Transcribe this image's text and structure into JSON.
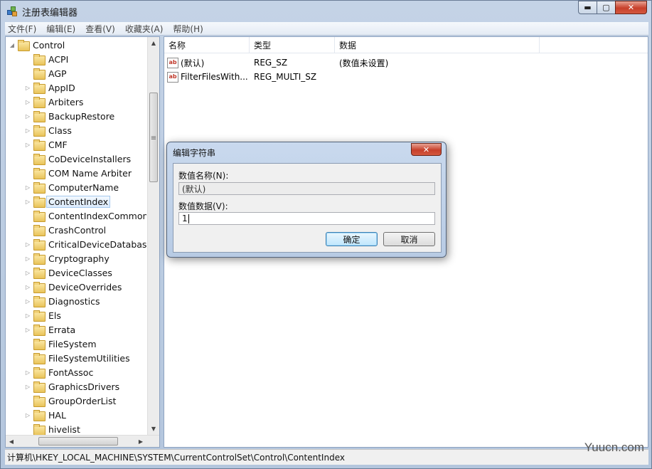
{
  "window": {
    "title": "注册表编辑器",
    "minimize_glyph": "▬",
    "maximize_glyph": "▢",
    "close_glyph": "✕"
  },
  "menu": [
    "文件(F)",
    "编辑(E)",
    "查看(V)",
    "收藏夹(A)",
    "帮助(H)"
  ],
  "tree": {
    "root": "Control",
    "root_expander": "◢",
    "collapsed_expander": "▷",
    "items": [
      {
        "label": "ACPI",
        "expandable": false
      },
      {
        "label": "AGP",
        "expandable": false
      },
      {
        "label": "AppID",
        "expandable": true
      },
      {
        "label": "Arbiters",
        "expandable": true
      },
      {
        "label": "BackupRestore",
        "expandable": true
      },
      {
        "label": "Class",
        "expandable": true
      },
      {
        "label": "CMF",
        "expandable": true
      },
      {
        "label": "CoDeviceInstallers",
        "expandable": false
      },
      {
        "label": "COM Name Arbiter",
        "expandable": false
      },
      {
        "label": "ComputerName",
        "expandable": true
      },
      {
        "label": "ContentIndex",
        "expandable": true,
        "selected": true
      },
      {
        "label": "ContentIndexCommon",
        "expandable": false
      },
      {
        "label": "CrashControl",
        "expandable": false
      },
      {
        "label": "CriticalDeviceDatabase",
        "expandable": true
      },
      {
        "label": "Cryptography",
        "expandable": true
      },
      {
        "label": "DeviceClasses",
        "expandable": true
      },
      {
        "label": "DeviceOverrides",
        "expandable": true
      },
      {
        "label": "Diagnostics",
        "expandable": true
      },
      {
        "label": "Els",
        "expandable": true
      },
      {
        "label": "Errata",
        "expandable": true
      },
      {
        "label": "FileSystem",
        "expandable": false
      },
      {
        "label": "FileSystemUtilities",
        "expandable": false
      },
      {
        "label": "FontAssoc",
        "expandable": true
      },
      {
        "label": "GraphicsDrivers",
        "expandable": true
      },
      {
        "label": "GroupOrderList",
        "expandable": false
      },
      {
        "label": "HAL",
        "expandable": true
      },
      {
        "label": "hivelist",
        "expandable": false
      }
    ]
  },
  "scroll": {
    "up": "▲",
    "down": "▼",
    "left": "◀",
    "right": "▶",
    "grip": "≡"
  },
  "list": {
    "columns": [
      "名称",
      "类型",
      "数据"
    ],
    "icon_text": "ab",
    "rows": [
      {
        "name": "(默认)",
        "type": "REG_SZ",
        "data": "(数值未设置)"
      },
      {
        "name": "FilterFilesWith...",
        "type": "REG_MULTI_SZ",
        "data": ""
      }
    ]
  },
  "status": {
    "path": "计算机\\HKEY_LOCAL_MACHINE\\SYSTEM\\CurrentControlSet\\Control\\ContentIndex"
  },
  "dialog": {
    "title": "编辑字符串",
    "close_glyph": "✕",
    "name_label": "数值名称(N):",
    "name_value": "(默认)",
    "data_label": "数值数据(V):",
    "data_value": "1",
    "ok_label": "确定",
    "cancel_label": "取消"
  },
  "watermark": "Yuucn.com"
}
